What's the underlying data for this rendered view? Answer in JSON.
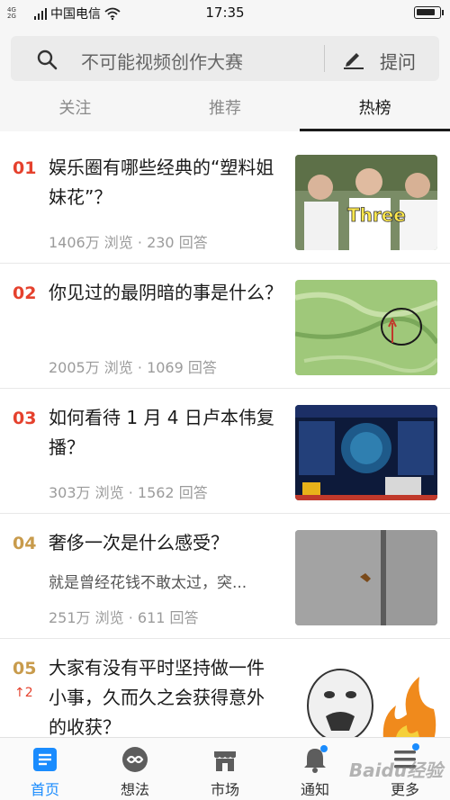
{
  "status_bar": {
    "signal_top": "4G",
    "signal_bottom": "2G",
    "carrier": "中国电信",
    "time": "17:35",
    "battery_level": 0.85
  },
  "search": {
    "placeholder": "不可能视频创作大赛",
    "ask_label": "提问"
  },
  "tabs": [
    {
      "label": "关注",
      "active": false
    },
    {
      "label": "推荐",
      "active": false
    },
    {
      "label": "热榜",
      "active": true
    }
  ],
  "items": [
    {
      "rank": "01",
      "title": "娱乐圈有哪些经典的“塑料姐妹花”？",
      "meta": "1406万 浏览 · 230 回答",
      "thumb_text": "Three"
    },
    {
      "rank": "02",
      "title": "你见过的最阴暗的事是什么？",
      "meta": "2005万 浏览 · 1069 回答"
    },
    {
      "rank": "03",
      "title": "如何看待 1 月 4 日卢本伟复播？",
      "meta": "303万 浏览 · 1562 回答"
    },
    {
      "rank": "04",
      "title": "奢侈一次是什么感受？",
      "excerpt": "就是曾经花钱不敢太过，突...",
      "meta": "251万 浏览 · 611 回答"
    },
    {
      "rank": "05",
      "trend": "↑2",
      "title": "大家有没有平时坚持做一件小事，久而久之会获得意外的收获？"
    }
  ],
  "bottom_nav": [
    {
      "label": "首页",
      "icon": "home-icon",
      "active": true
    },
    {
      "label": "想法",
      "icon": "ideas-icon",
      "active": false
    },
    {
      "label": "市场",
      "icon": "market-icon",
      "active": false
    },
    {
      "label": "通知",
      "icon": "bell-icon",
      "active": false
    },
    {
      "label": "更多",
      "icon": "menu-icon",
      "active": false
    }
  ],
  "watermark": "Baidu经验",
  "colors": {
    "hot_rank": "#e5412d",
    "warm_rank": "#c89b4c",
    "accent": "#1a8cfe"
  }
}
